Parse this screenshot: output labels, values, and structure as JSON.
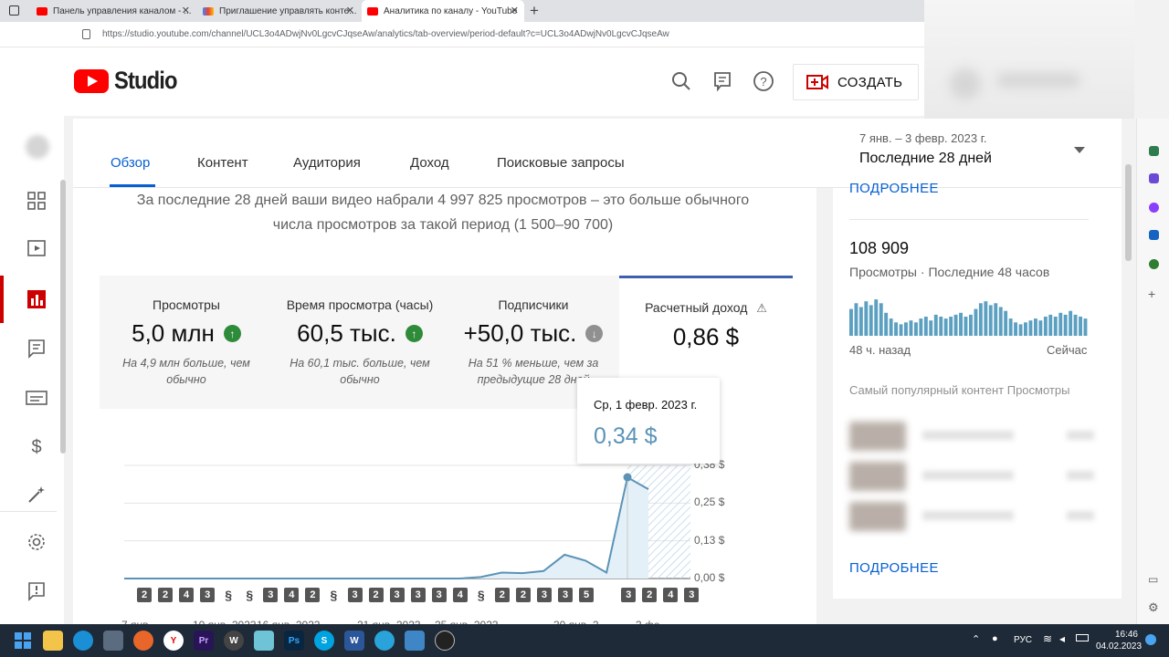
{
  "browser": {
    "tabs": [
      {
        "title": "Панель управления каналом - ..."
      },
      {
        "title": "Приглашение управлять конте..."
      },
      {
        "title": "Аналитика по каналу - YouTube"
      }
    ],
    "new_tab": "+",
    "url": "https://studio.youtube.com/channel/UCL3o4ADwjNv0LgcvCJqseAw/analytics/tab-overview/period-default?c=UCL3o4ADwjNv0LgcvCJqseAw"
  },
  "header": {
    "logo_text": "Studio",
    "create_label": "СОЗДАТЬ"
  },
  "tabs": [
    {
      "label": "Обзор",
      "active": true
    },
    {
      "label": "Контент"
    },
    {
      "label": "Аудитория"
    },
    {
      "label": "Доход"
    },
    {
      "label": "Поисковые запросы"
    }
  ],
  "date_range": {
    "dates": "7 янв. – 3 февр. 2023 г.",
    "period": "Последние 28 дней"
  },
  "summary": {
    "line1": "За последние 28 дней ваши видео набрали 4 997 825 просмотров – это больше обычного",
    "line2": "числа просмотров за такой период (1 500–90 700)"
  },
  "metrics": [
    {
      "label": "Просмотры",
      "value": "5,0 млн",
      "trend": "up",
      "note": "На 4,9 млн больше, чем обычно"
    },
    {
      "label": "Время просмотра (часы)",
      "value": "60,5 тыс.",
      "trend": "up",
      "note": "На 60,1 тыс. больше, чем обычно"
    },
    {
      "label": "Подписчики",
      "value": "+50,0 тыс.",
      "trend": "down",
      "note": "На 51 % меньше, чем за предыдущие 28 дней"
    },
    {
      "label": "Расчетный доход",
      "value": "0,86 $",
      "trend": "none",
      "note": "",
      "selected": true
    }
  ],
  "tooltip": {
    "date": "Ср, 1 февр. 2023 г.",
    "value": "0,34 $"
  },
  "chart_data": {
    "type": "line",
    "title": "",
    "ylabel": "",
    "y_ticks": [
      "0,00 $",
      "0,13 $",
      "0,25 $",
      "0,38 $"
    ],
    "ylim": [
      0,
      0.38
    ],
    "x_tick_labels": [
      "7 янв.",
      "10 янв. 2023",
      "16 янв. 2023",
      "21 янв. 2023",
      "25 янв. 2023",
      "30 янв. 2",
      "3 фе"
    ],
    "series": [
      {
        "values": [
          0,
          0,
          0,
          0,
          0,
          0,
          0,
          0,
          0,
          0,
          0,
          0,
          0,
          0,
          0,
          0,
          0,
          0.005,
          0.02,
          0.018,
          0.025,
          0.08,
          0.06,
          0.02,
          0.34,
          0.3
        ]
      }
    ],
    "video_badges": [
      "2",
      "2",
      "4",
      "3",
      "s",
      "s",
      "3",
      "4",
      "2",
      "s",
      "3",
      "2",
      "3",
      "3",
      "3",
      "4",
      "s",
      "2",
      "2",
      "3",
      "3",
      "5",
      "",
      "3",
      "2",
      "4",
      "3"
    ]
  },
  "right_panel": {
    "more_top": "ПОДРОБНЕЕ",
    "views_value": "108 909",
    "views_label": "Просмотры · Последние 48 часов",
    "hours_ago": "48 ч. назад",
    "now": "Сейчас",
    "popular_label": "Самый популярный контент Просмотры",
    "more_bottom": "ПОДРОБНЕЕ",
    "bars": [
      0.7,
      0.85,
      0.75,
      0.9,
      0.8,
      0.95,
      0.85,
      0.6,
      0.45,
      0.35,
      0.3,
      0.35,
      0.4,
      0.35,
      0.45,
      0.5,
      0.4,
      0.55,
      0.5,
      0.45,
      0.5,
      0.55,
      0.6,
      0.5,
      0.55,
      0.7,
      0.85,
      0.9,
      0.8,
      0.85,
      0.75,
      0.65,
      0.45,
      0.35,
      0.3,
      0.35,
      0.4,
      0.45,
      0.4,
      0.5,
      0.55,
      0.5,
      0.6,
      0.55,
      0.65,
      0.55,
      0.5,
      0.45
    ]
  },
  "taskbar": {
    "lang": "РУС",
    "time": "16:46",
    "date": "04.02.2023"
  },
  "colors": {
    "accent": "#065fd4",
    "brand": "#ff0000",
    "chart_line": "#5b93b7",
    "up": "#2e8b3a",
    "down": "#909090"
  }
}
